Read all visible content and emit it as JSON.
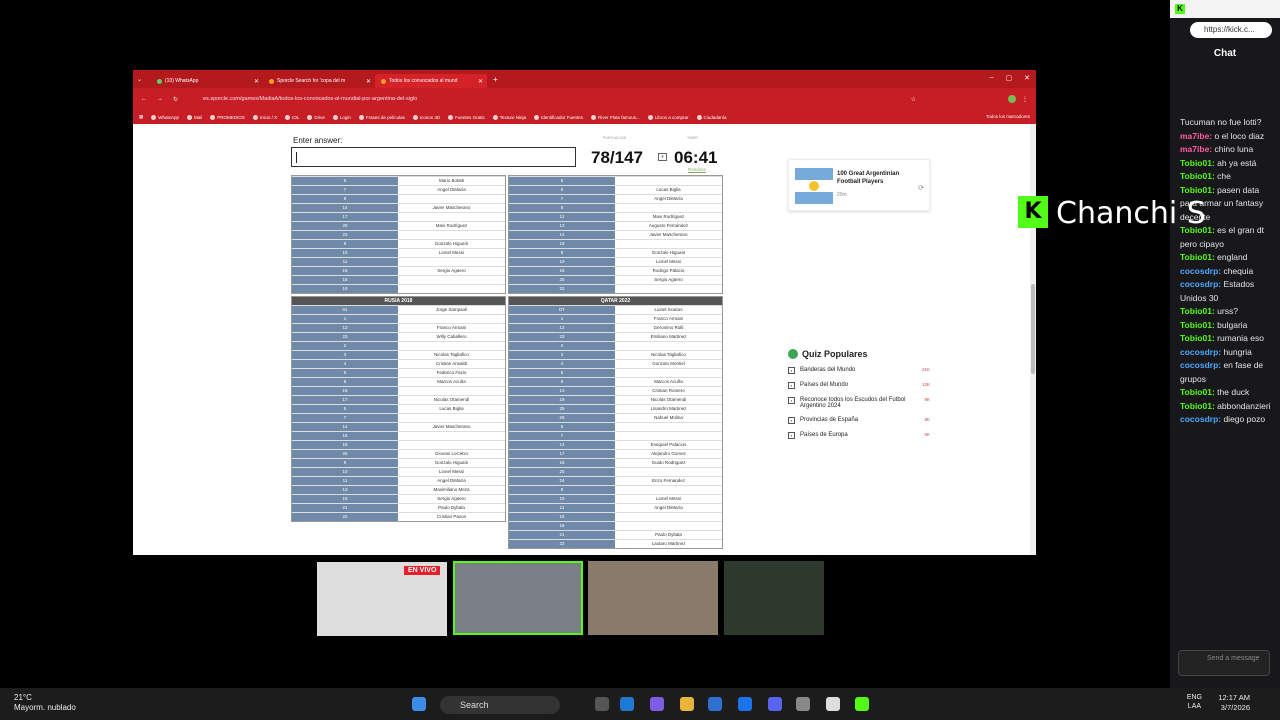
{
  "browser": {
    "tabs": [
      {
        "label": "(10) WhatsApp"
      },
      {
        "label": "Sporcle Search for 'copa del m"
      },
      {
        "label": "Todos los convocados al mund"
      }
    ],
    "url": "es.sporcle.com/games/MadiaA/todos-los-convocados-al-mundial-por-argentina-del-siglo",
    "bookmarks": [
      "WhatsApp",
      "Mail",
      "PROMEDIOS",
      "Inicio / X",
      "IOL",
      "Drive",
      "Login",
      "Frases de películas",
      "Iconos 3D",
      "Fuentes Gratis",
      "Texture Ninja",
      "Identificador Fuentes",
      "River Plate famous...",
      "Libros a comprar",
      "Ciudadanía"
    ],
    "bookmarks_right": "Todos los marcadores"
  },
  "quiz": {
    "enter_answer": "Enter answer:",
    "score_label": "PUNTUACIÓN",
    "timer_label": "TIMER",
    "score": "78/147",
    "timer": "06:41",
    "give_up": "Rendirse",
    "pause_icon": "pause-icon",
    "top_left": [
      [
        "5",
        "Mario Bolatti"
      ],
      [
        "7",
        "Angel DiMaría"
      ],
      [
        "8",
        ""
      ],
      [
        "14",
        "Javier Mascherano"
      ],
      [
        "17",
        ""
      ],
      [
        "20",
        "Maxi Rodríguez"
      ],
      [
        "23",
        ""
      ],
      [
        "9",
        "Gonzalo Higuaín"
      ],
      [
        "10",
        "Lionel Messi"
      ],
      [
        "11",
        ""
      ],
      [
        "16",
        "Sergio Agüero"
      ],
      [
        "18",
        ""
      ],
      [
        "19",
        ""
      ]
    ],
    "top_right": [
      [
        "5",
        ""
      ],
      [
        "6",
        "Lucas Biglia"
      ],
      [
        "7",
        "Angel DiMaría"
      ],
      [
        "8",
        ""
      ],
      [
        "11",
        "Maxi Rodríguez"
      ],
      [
        "13",
        "Augusto Fernández"
      ],
      [
        "14",
        "Javier Mascherano"
      ],
      [
        "19",
        ""
      ],
      [
        "9",
        "Gonzalo Higuaín"
      ],
      [
        "10",
        "Lionel Messi"
      ],
      [
        "18",
        "Rodrigo Palacio"
      ],
      [
        "20",
        "Sergio Agüero"
      ],
      [
        "22",
        ""
      ]
    ],
    "russia_title": "RUSIA 2018",
    "qatar_title": "QATAR 2022",
    "russia": [
      [
        "01",
        "Jorge Sampaoli"
      ],
      [
        "1",
        ""
      ],
      [
        "12",
        "Franco Armani"
      ],
      [
        "23",
        "Willy Caballero"
      ],
      [
        "2",
        ""
      ],
      [
        "3",
        "Nicolas Tagliafico"
      ],
      [
        "4",
        "Cristian Ansaldi"
      ],
      [
        "6",
        "Federico Fazio"
      ],
      [
        "8",
        "Marcos Acuña"
      ],
      [
        "16",
        ""
      ],
      [
        "17",
        "Nicolas Otamendi"
      ],
      [
        "5",
        "Lucas Biglia"
      ],
      [
        "7",
        ""
      ],
      [
        "14",
        "Javier Mascherano"
      ],
      [
        "15",
        ""
      ],
      [
        "18",
        ""
      ],
      [
        "20",
        "Giovani LoCelso"
      ],
      [
        "9",
        "Gonzalo Higuaín"
      ],
      [
        "10",
        "Lionel Messi"
      ],
      [
        "11",
        "Angel DiMaría"
      ],
      [
        "13",
        "Maximiliano Meza"
      ],
      [
        "19",
        "Sergio Agüero"
      ],
      [
        "21",
        "Paulo Dybala"
      ],
      [
        "22",
        "Cristian Pavon"
      ]
    ],
    "qatar": [
      [
        "DT",
        "Lionel Scaloni"
      ],
      [
        "1",
        "Franco Armani"
      ],
      [
        "12",
        "Geronimo Rulli"
      ],
      [
        "23",
        "Emiliano Martinez"
      ],
      [
        "2",
        ""
      ],
      [
        "3",
        "Nicolas Tagliafico"
      ],
      [
        "4",
        "Gonzalo Montiel"
      ],
      [
        "6",
        ""
      ],
      [
        "8",
        "Marcos Acuña"
      ],
      [
        "13",
        "Cristian Romero"
      ],
      [
        "19",
        "Nicolas Otamendi"
      ],
      [
        "25",
        "Lisandro Martinez"
      ],
      [
        "26",
        "Nahuel Molina"
      ],
      [
        "5",
        ""
      ],
      [
        "7",
        ""
      ],
      [
        "14",
        "Exequiel Palacios"
      ],
      [
        "17",
        "Alejandro Gomez"
      ],
      [
        "18",
        "Guido Rodriguez"
      ],
      [
        "20",
        ""
      ],
      [
        "24",
        "Enzo Fernandez"
      ],
      [
        "9",
        ""
      ],
      [
        "10",
        "Lionel Messi"
      ],
      [
        "11",
        "Angel DiMaría"
      ],
      [
        "15",
        ""
      ],
      [
        "16",
        ""
      ],
      [
        "21",
        "Paulo Dybala"
      ],
      [
        "22",
        "Lautaro Martinez"
      ]
    ],
    "card": {
      "title": "100 Great Argentinian Football Players",
      "meta": "20m"
    },
    "popular_title": "Quiz Populares",
    "popular": [
      {
        "label": "Banderas del Mundo",
        "count": "21K"
      },
      {
        "label": "Países del Mundo",
        "count": "12K"
      },
      {
        "label": "Reconoce todos los Escudos del Futbol Argentino 2024",
        "count": "9K"
      },
      {
        "label": "Provincias de España",
        "count": "8K"
      },
      {
        "label": "Países de Europa",
        "count": "5K"
      }
    ]
  },
  "stream": {
    "live": "EN VIVO",
    "overlay": "Chanchi S"
  },
  "chat": {
    "title": "Chat",
    "url": "https://kick.c...",
    "messages": [
      {
        "user": "",
        "text": "Tucuman no fue lotti?",
        "color": "#e5e5e5"
      },
      {
        "user": "ma7ibe:",
        "text": " o el loco diaz",
        "color": "#ff5aa8"
      },
      {
        "user": "ma7ibe:",
        "text": " chino luna",
        "color": "#ff5aa8"
      },
      {
        "user": "Tobio01:",
        "text": " ah ya está",
        "color": "#53fc18"
      },
      {
        "user": "Tobio01:",
        "text": " che",
        "color": "#53fc18"
      },
      {
        "user": "Tobio01:",
        "text": " pasen data para armar un fantasy decente",
        "color": "#53fc18"
      },
      {
        "user": "Tobio01:",
        "text": " es el gran dt pero cipayo",
        "color": "#53fc18"
      },
      {
        "user": "Tobio01:",
        "text": " england",
        "color": "#53fc18"
      },
      {
        "user": "cocosdrp:",
        "text": " chequia",
        "color": "#4aa8ff"
      },
      {
        "user": "cocosdrp:",
        "text": " Estados Unidos 30",
        "color": "#4aa8ff"
      },
      {
        "user": "Tobio01:",
        "text": " urss?",
        "color": "#53fc18"
      },
      {
        "user": "Tobio01:",
        "text": " bulgaria",
        "color": "#53fc18"
      },
      {
        "user": "Tobio01:",
        "text": " rumania eso",
        "color": "#53fc18"
      },
      {
        "user": "cocosdrp:",
        "text": " hungria",
        "color": "#4aa8ff"
      },
      {
        "user": "cocosdrp:",
        "text": " en fase de grupos",
        "color": "#4aa8ff"
      },
      {
        "user": "Tobio01:",
        "text": " the duck",
        "color": "#53fc18"
      },
      {
        "user": "Tobio01:",
        "text": " abbondanzieri",
        "color": "#53fc18"
      },
      {
        "user": "cocosdrp:",
        "text": " diego pozo",
        "color": "#4aa8ff"
      }
    ],
    "send_placeholder": "Send a message"
  },
  "taskbar": {
    "temp": "21°C",
    "weather": "Mayorm. nublado",
    "search": "Search",
    "lang1": "ENG",
    "lang2": "LAA",
    "time": "12:17 AM",
    "date": "3/7/2026"
  }
}
